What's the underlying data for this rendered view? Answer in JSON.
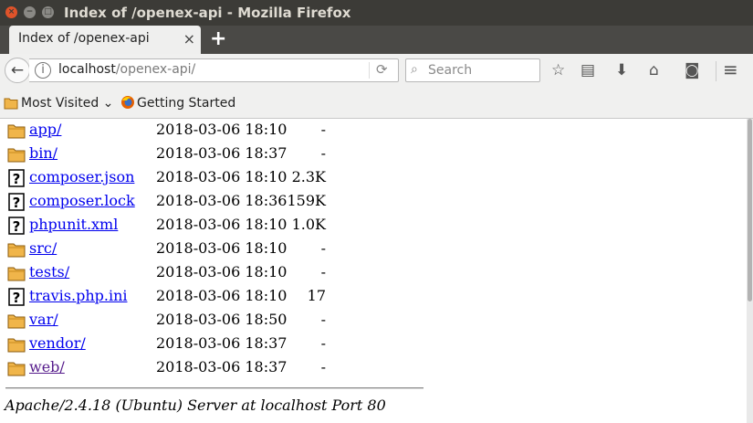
{
  "window": {
    "title": "Index of /openex-api - Mozilla Firefox",
    "close": "×",
    "minimize": "−",
    "maximize": "□"
  },
  "tab": {
    "label": "Index of /openex-api",
    "close": "×",
    "new": "+"
  },
  "nav": {
    "back": "←",
    "info": "i",
    "url_host": "localhost",
    "url_path": "/openex-api/",
    "reload": "⟳",
    "search_placeholder": "Search",
    "search_glyph": "⌕"
  },
  "toolbar": {
    "bookmark": "☆",
    "library": "▤",
    "download": "⬇",
    "home": "⌂",
    "pocket": "◙",
    "menu": "≡"
  },
  "bookmarks": [
    {
      "label": "Most Visited",
      "chevron": "⌄",
      "icon": "folder-icon"
    },
    {
      "label": "Getting Started",
      "icon": "firefox-icon"
    }
  ],
  "listing": [
    {
      "name": "app/",
      "date": "2018-03-06 18:10",
      "size": "-",
      "type": "folder"
    },
    {
      "name": "bin/",
      "date": "2018-03-06 18:37",
      "size": "-",
      "type": "folder"
    },
    {
      "name": "composer.json",
      "date": "2018-03-06 18:10",
      "size": "2.3K",
      "type": "file"
    },
    {
      "name": "composer.lock",
      "date": "2018-03-06 18:36",
      "size": "159K",
      "type": "file"
    },
    {
      "name": "phpunit.xml",
      "date": "2018-03-06 18:10",
      "size": "1.0K",
      "type": "file"
    },
    {
      "name": "src/",
      "date": "2018-03-06 18:10",
      "size": "-",
      "type": "folder"
    },
    {
      "name": "tests/",
      "date": "2018-03-06 18:10",
      "size": "-",
      "type": "folder"
    },
    {
      "name": "travis.php.ini",
      "date": "2018-03-06 18:10",
      "size": "17",
      "type": "file"
    },
    {
      "name": "var/",
      "date": "2018-03-06 18:50",
      "size": "-",
      "type": "folder"
    },
    {
      "name": "vendor/",
      "date": "2018-03-06 18:37",
      "size": "-",
      "type": "folder"
    },
    {
      "name": "web/",
      "date": "2018-03-06 18:37",
      "size": "-",
      "type": "folder",
      "visited": true
    }
  ],
  "footer": {
    "address": "Apache/2.4.18 (Ubuntu) Server at localhost Port 80"
  }
}
